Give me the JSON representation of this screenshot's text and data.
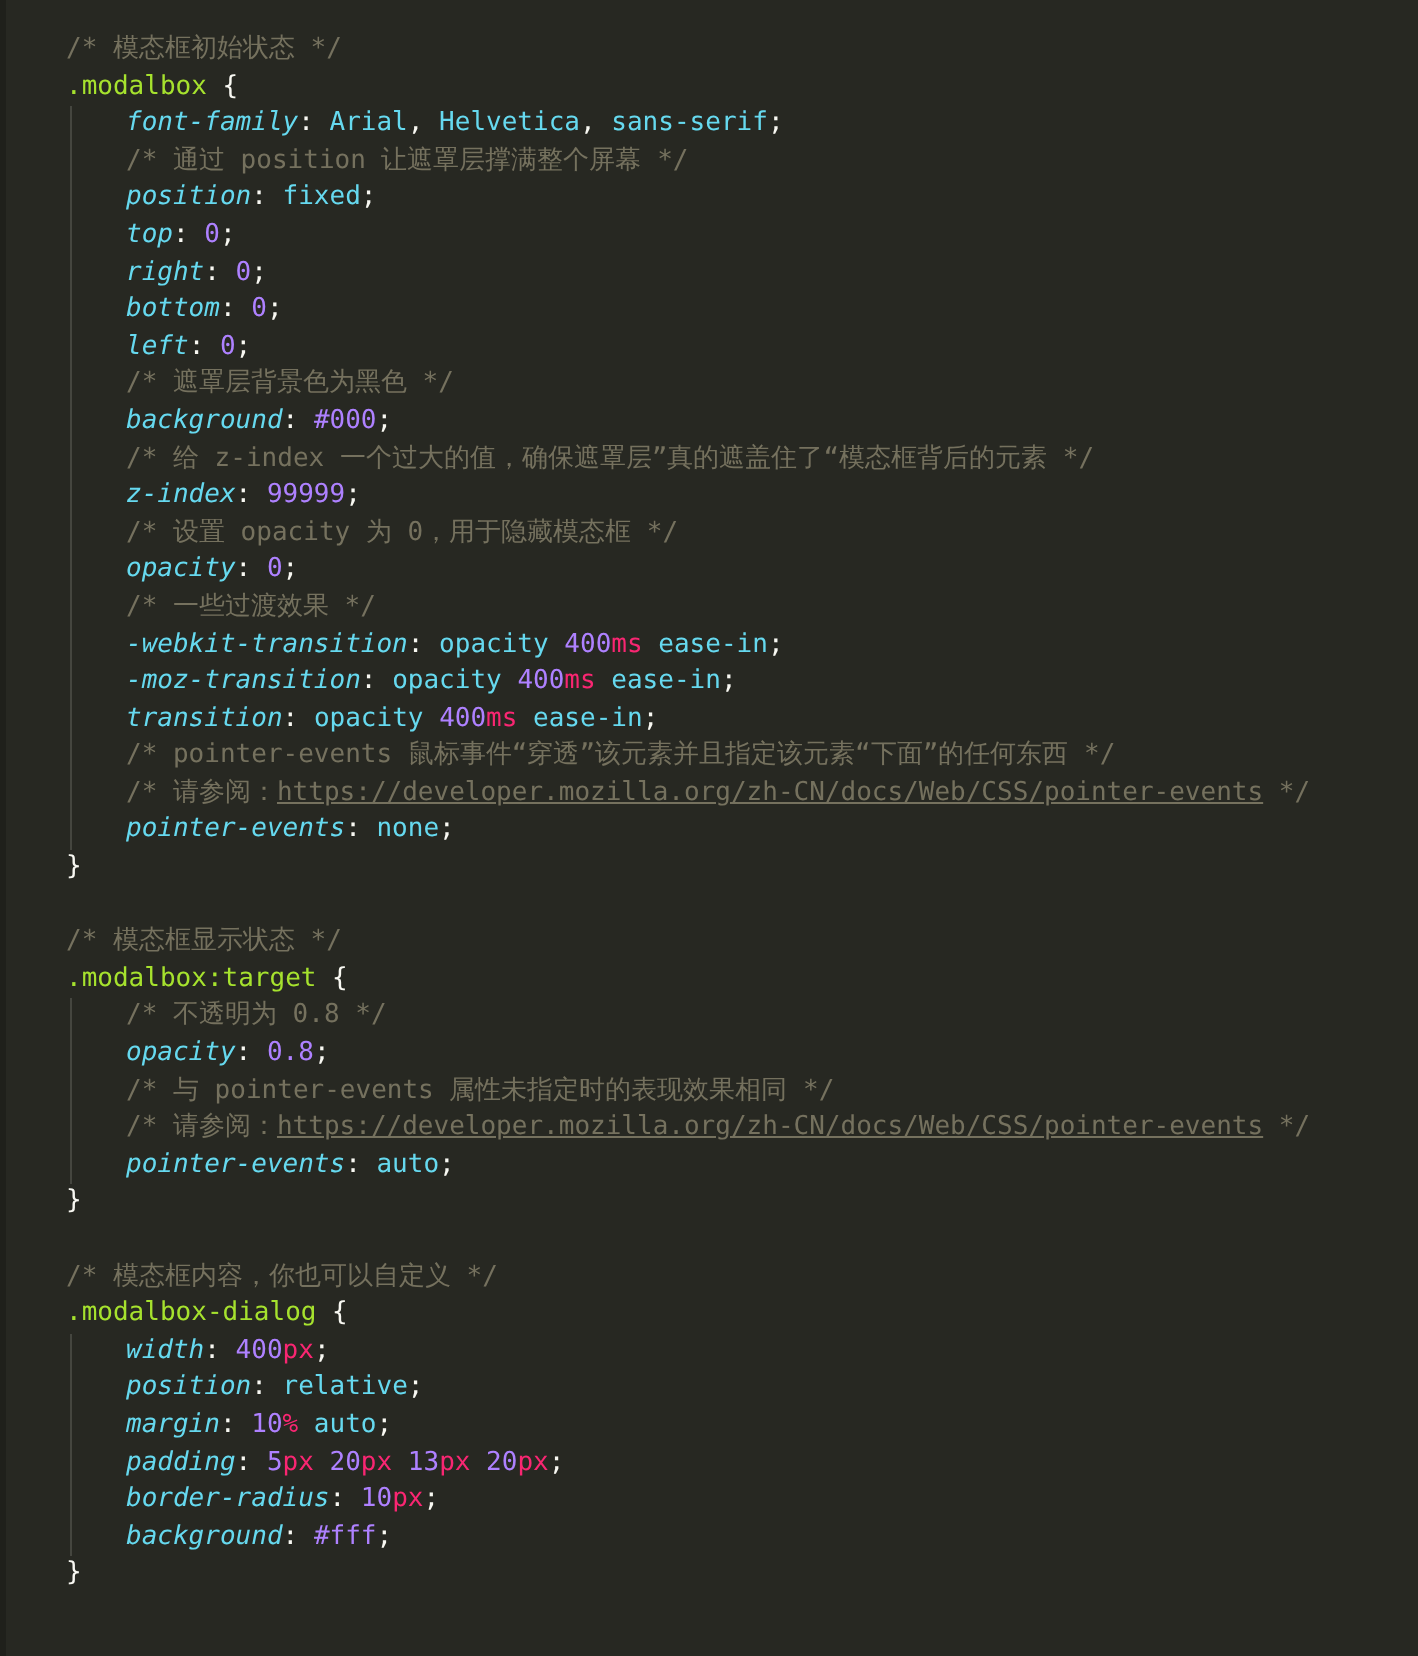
{
  "blocks": [
    {
      "comment": "/* 模态框初始状态 */",
      "selector": ".modalbox",
      "open": "{",
      "close": "}",
      "body": [
        [
          {
            "kind": "property",
            "text": "font-family"
          },
          {
            "kind": "punct",
            "text": ": "
          },
          {
            "kind": "keyword",
            "text": "Arial"
          },
          {
            "kind": "punct",
            "text": ", "
          },
          {
            "kind": "keyword",
            "text": "Helvetica"
          },
          {
            "kind": "punct",
            "text": ", "
          },
          {
            "kind": "keyword",
            "text": "sans-serif"
          },
          {
            "kind": "punct",
            "text": ";"
          }
        ],
        [
          {
            "kind": "comment",
            "text": "/* 通过 position 让遮罩层撑满整个屏幕 */"
          }
        ],
        [
          {
            "kind": "property",
            "text": "position"
          },
          {
            "kind": "punct",
            "text": ": "
          },
          {
            "kind": "keyword",
            "text": "fixed"
          },
          {
            "kind": "punct",
            "text": ";"
          }
        ],
        [
          {
            "kind": "property",
            "text": "top"
          },
          {
            "kind": "punct",
            "text": ": "
          },
          {
            "kind": "number",
            "text": "0"
          },
          {
            "kind": "punct",
            "text": ";"
          }
        ],
        [
          {
            "kind": "property",
            "text": "right"
          },
          {
            "kind": "punct",
            "text": ": "
          },
          {
            "kind": "number",
            "text": "0"
          },
          {
            "kind": "punct",
            "text": ";"
          }
        ],
        [
          {
            "kind": "property",
            "text": "bottom"
          },
          {
            "kind": "punct",
            "text": ": "
          },
          {
            "kind": "number",
            "text": "0"
          },
          {
            "kind": "punct",
            "text": ";"
          }
        ],
        [
          {
            "kind": "property",
            "text": "left"
          },
          {
            "kind": "punct",
            "text": ": "
          },
          {
            "kind": "number",
            "text": "0"
          },
          {
            "kind": "punct",
            "text": ";"
          }
        ],
        [
          {
            "kind": "comment",
            "text": "/* 遮罩层背景色为黑色 */"
          }
        ],
        [
          {
            "kind": "property",
            "text": "background"
          },
          {
            "kind": "punct",
            "text": ": "
          },
          {
            "kind": "number",
            "text": "#000"
          },
          {
            "kind": "punct",
            "text": ";"
          }
        ],
        [
          {
            "kind": "comment",
            "text": "/* 给 z-index 一个过大的值，确保遮罩层”真的遮盖住了“模态框背后的元素 */"
          }
        ],
        [
          {
            "kind": "property",
            "text": "z-index"
          },
          {
            "kind": "punct",
            "text": ": "
          },
          {
            "kind": "number",
            "text": "99999"
          },
          {
            "kind": "punct",
            "text": ";"
          }
        ],
        [
          {
            "kind": "comment",
            "text": "/* 设置 opacity 为 0，用于隐藏模态框 */"
          }
        ],
        [
          {
            "kind": "property",
            "text": "opacity"
          },
          {
            "kind": "punct",
            "text": ": "
          },
          {
            "kind": "number",
            "text": "0"
          },
          {
            "kind": "punct",
            "text": ";"
          }
        ],
        [
          {
            "kind": "comment",
            "text": "/* 一些过渡效果 */"
          }
        ],
        [
          {
            "kind": "property",
            "text": "-webkit-transition"
          },
          {
            "kind": "punct",
            "text": ": "
          },
          {
            "kind": "keyword",
            "text": "opacity "
          },
          {
            "kind": "number",
            "text": "400"
          },
          {
            "kind": "unit",
            "text": "ms"
          },
          {
            "kind": "keyword",
            "text": " ease-in"
          },
          {
            "kind": "punct",
            "text": ";"
          }
        ],
        [
          {
            "kind": "property",
            "text": "-moz-transition"
          },
          {
            "kind": "punct",
            "text": ": "
          },
          {
            "kind": "keyword",
            "text": "opacity "
          },
          {
            "kind": "number",
            "text": "400"
          },
          {
            "kind": "unit",
            "text": "ms"
          },
          {
            "kind": "keyword",
            "text": " ease-in"
          },
          {
            "kind": "punct",
            "text": ";"
          }
        ],
        [
          {
            "kind": "property",
            "text": "transition"
          },
          {
            "kind": "punct",
            "text": ": "
          },
          {
            "kind": "keyword",
            "text": "opacity "
          },
          {
            "kind": "number",
            "text": "400"
          },
          {
            "kind": "unit",
            "text": "ms"
          },
          {
            "kind": "keyword",
            "text": " ease-in"
          },
          {
            "kind": "punct",
            "text": ";"
          }
        ],
        [
          {
            "kind": "comment",
            "text": "/* pointer-events 鼠标事件“穿透”该元素并且指定该元素“下面”的任何东西 */"
          }
        ],
        [
          {
            "kind": "comment",
            "text": "/* 请参阅："
          },
          {
            "kind": "link",
            "text": "https://developer.mozilla.org/zh-CN/docs/Web/CSS/pointer-events"
          },
          {
            "kind": "comment",
            "text": " */"
          }
        ],
        [
          {
            "kind": "property",
            "text": "pointer-events"
          },
          {
            "kind": "punct",
            "text": ": "
          },
          {
            "kind": "keyword",
            "text": "none"
          },
          {
            "kind": "punct",
            "text": ";"
          }
        ]
      ]
    },
    {
      "comment": "/* 模态框显示状态 */",
      "selector": ".modalbox:target",
      "open": "{",
      "close": "}",
      "body": [
        [
          {
            "kind": "comment",
            "text": "/* 不透明为 0.8 */"
          }
        ],
        [
          {
            "kind": "property",
            "text": "opacity"
          },
          {
            "kind": "punct",
            "text": ": "
          },
          {
            "kind": "number",
            "text": "0.8"
          },
          {
            "kind": "punct",
            "text": ";"
          }
        ],
        [
          {
            "kind": "comment",
            "text": "/* 与 pointer-events 属性未指定时的表现效果相同 */"
          }
        ],
        [
          {
            "kind": "comment",
            "text": "/* 请参阅："
          },
          {
            "kind": "link",
            "text": "https://developer.mozilla.org/zh-CN/docs/Web/CSS/pointer-events"
          },
          {
            "kind": "comment",
            "text": " */"
          }
        ],
        [
          {
            "kind": "property",
            "text": "pointer-events"
          },
          {
            "kind": "punct",
            "text": ": "
          },
          {
            "kind": "keyword",
            "text": "auto"
          },
          {
            "kind": "punct",
            "text": ";"
          }
        ]
      ]
    },
    {
      "comment": "/* 模态框内容，你也可以自定义 */",
      "selector": ".modalbox-dialog",
      "open": "{",
      "close": "}",
      "body": [
        [
          {
            "kind": "property",
            "text": "width"
          },
          {
            "kind": "punct",
            "text": ": "
          },
          {
            "kind": "number",
            "text": "400"
          },
          {
            "kind": "unit",
            "text": "px"
          },
          {
            "kind": "punct",
            "text": ";"
          }
        ],
        [
          {
            "kind": "property",
            "text": "position"
          },
          {
            "kind": "punct",
            "text": ": "
          },
          {
            "kind": "keyword",
            "text": "relative"
          },
          {
            "kind": "punct",
            "text": ";"
          }
        ],
        [
          {
            "kind": "property",
            "text": "margin"
          },
          {
            "kind": "punct",
            "text": ": "
          },
          {
            "kind": "number",
            "text": "10"
          },
          {
            "kind": "unit",
            "text": "%"
          },
          {
            "kind": "keyword",
            "text": " auto"
          },
          {
            "kind": "punct",
            "text": ";"
          }
        ],
        [
          {
            "kind": "property",
            "text": "padding"
          },
          {
            "kind": "punct",
            "text": ": "
          },
          {
            "kind": "number",
            "text": "5"
          },
          {
            "kind": "unit",
            "text": "px"
          },
          {
            "kind": "number",
            "text": " 20"
          },
          {
            "kind": "unit",
            "text": "px"
          },
          {
            "kind": "number",
            "text": " 13"
          },
          {
            "kind": "unit",
            "text": "px"
          },
          {
            "kind": "number",
            "text": " 20"
          },
          {
            "kind": "unit",
            "text": "px"
          },
          {
            "kind": "punct",
            "text": ";"
          }
        ],
        [
          {
            "kind": "property",
            "text": "border-radius"
          },
          {
            "kind": "punct",
            "text": ": "
          },
          {
            "kind": "number",
            "text": "10"
          },
          {
            "kind": "unit",
            "text": "px"
          },
          {
            "kind": "punct",
            "text": ";"
          }
        ],
        [
          {
            "kind": "property",
            "text": "background"
          },
          {
            "kind": "punct",
            "text": ": "
          },
          {
            "kind": "number",
            "text": "#fff"
          },
          {
            "kind": "punct",
            "text": ";"
          }
        ]
      ]
    }
  ]
}
